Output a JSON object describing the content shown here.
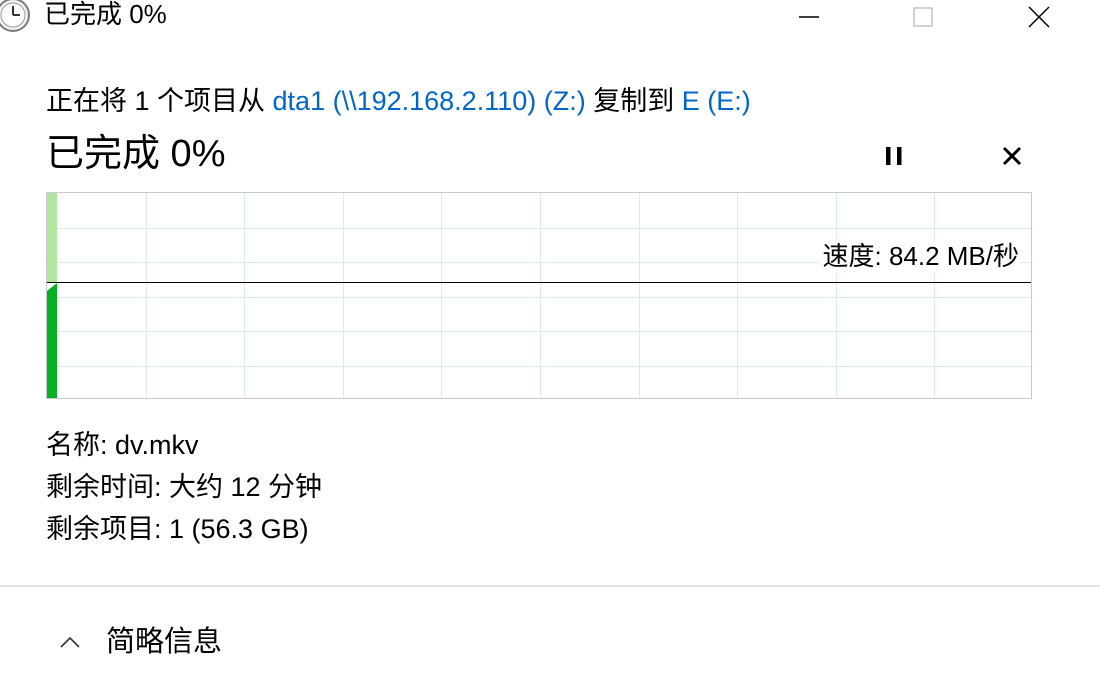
{
  "window": {
    "title": "已完成 0%",
    "icons": {
      "app": "clock-icon",
      "minimize": "minimize-icon",
      "maximize": "maximize-icon",
      "close": "close-icon"
    }
  },
  "copy": {
    "prefix": "正在将 1 个项目从 ",
    "source": "dta1 (\\\\192.168.2.110) (Z:)",
    "middle": " 复制到 ",
    "destination": "E (E:)"
  },
  "progress": {
    "label": "已完成 0%",
    "percent": 0,
    "icons": {
      "pause": "pause-icon",
      "cancel": "close-icon"
    }
  },
  "graph": {
    "speed_label": "速度: 84.2 MB/秒",
    "colors": {
      "fill": "#06b025",
      "fill_light": "#b3e5a1",
      "grid": "#d7efdc",
      "line": "#000000"
    }
  },
  "details": {
    "name": "名称: dv.mkv",
    "time_remaining": "剩余时间: 大约 12 分钟",
    "items_remaining": "剩余项目: 1 (56.3 GB)"
  },
  "footer": {
    "toggle_label": "简略信息",
    "toggle_icon": "chevron-up-icon"
  }
}
